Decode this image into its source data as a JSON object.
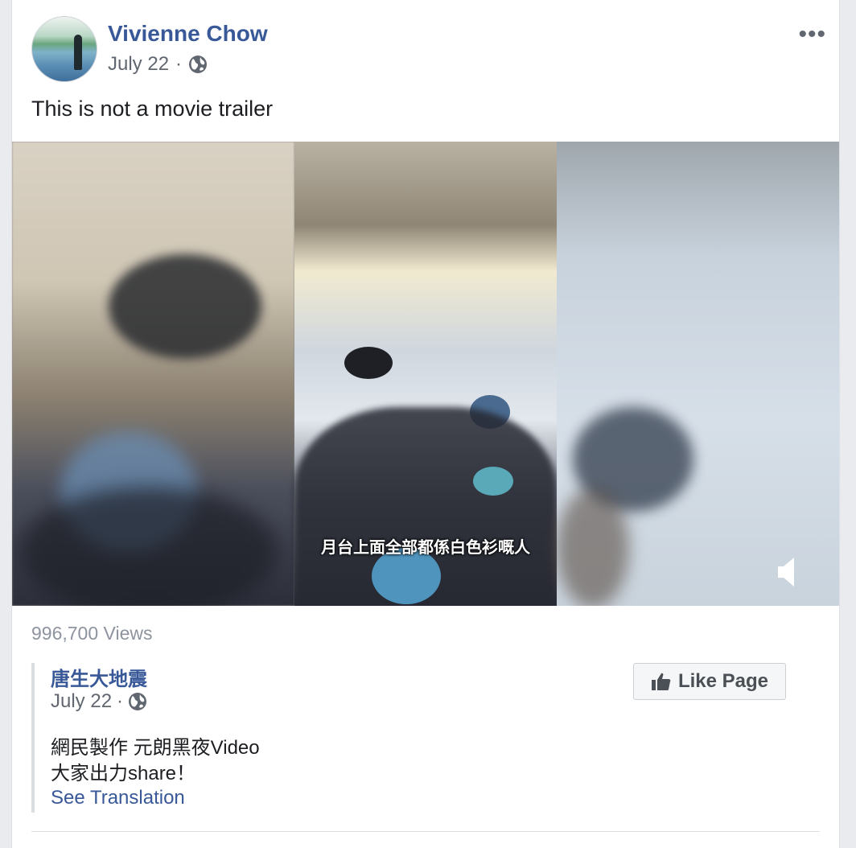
{
  "post": {
    "author": "Vivienne Chow",
    "date": "July 22",
    "separator": "·",
    "privacy_icon": "globe-icon",
    "more_label": "•••",
    "text": "This is not a movie trailer"
  },
  "video": {
    "subtitle": "月台上面全部都係白色衫嘅人",
    "sound_icon": "speaker-icon",
    "views": "996,700 Views"
  },
  "shared": {
    "page_name": "唐生大地震",
    "date": "July 22",
    "separator": "·",
    "privacy_icon": "globe-icon",
    "description_line1": "網民製作 元朗黑夜Video",
    "description_line2": "大家出力share！",
    "see_translation": "See Translation",
    "like_page_label": "Like Page"
  },
  "colors": {
    "link": "#385898",
    "meta": "#616770",
    "views": "#8d949e"
  }
}
